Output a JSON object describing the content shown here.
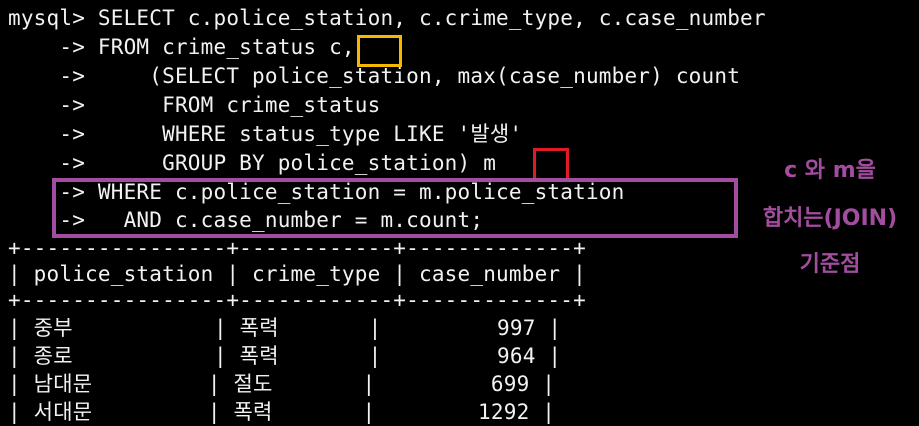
{
  "colors": {
    "background": "#000000",
    "text": "#f2f2f2",
    "yellow_box": "#f5b800",
    "red_box": "#e01b24",
    "purple_box": "#a24d9f",
    "annotation_text": "#a24d9f"
  },
  "query": {
    "lines": [
      "mysql> SELECT c.police_station, c.crime_type, c.case_number",
      "    -> FROM crime_status c,",
      "    ->     (SELECT police_station, max(case_number) count",
      "    ->      FROM crime_status",
      "    ->      WHERE status_type LIKE '발생'",
      "    ->      GROUP BY police_station) m",
      "    -> WHERE c.police_station = m.police_station",
      "    ->   AND c.case_number = m.count;"
    ]
  },
  "result_table": {
    "border": "+----------------+------------+-------------+",
    "header": "| police_station | crime_type | case_number |",
    "rows": [
      "| 중부           | 폭력       |         997 |",
      "| 종로           | 폭력       |         964 |",
      "| 남대문         | 절도       |         699 |",
      "| 서대문         | 폭력       |        1292 |"
    ]
  },
  "annotation": {
    "line1": "c 와 m을",
    "line2": "합치는(JOIN)",
    "line3": "기준점"
  }
}
